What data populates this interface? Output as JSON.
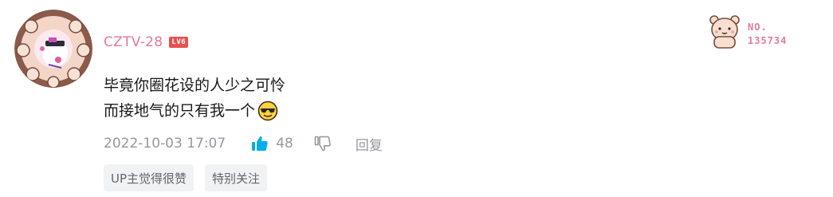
{
  "comment": {
    "user": {
      "name": "CZTV-28",
      "level_badge": "LV6",
      "name_color": "#e07b9a"
    },
    "content_lines": [
      "毕竟你圈花设的人少之可怜",
      "而接地气的只有我一个"
    ],
    "content_emoji": "sunglasses-emoji",
    "timestamp": "2022-10-03 17:07",
    "like_count": "48",
    "reply_label": "回复",
    "tags": [
      "UP主觉得很赞",
      "特别关注"
    ],
    "fan_badge": {
      "label": "NO.",
      "number": "135734"
    },
    "icons": {
      "like": "thumbs-up-icon",
      "dislike": "thumbs-down-icon"
    },
    "colors": {
      "accent_pink": "#e07b9a",
      "like_blue": "#00aeec",
      "meta_gray": "#9499a0",
      "tag_bg": "#f1f2f3",
      "level_red": "#e6524f"
    }
  }
}
